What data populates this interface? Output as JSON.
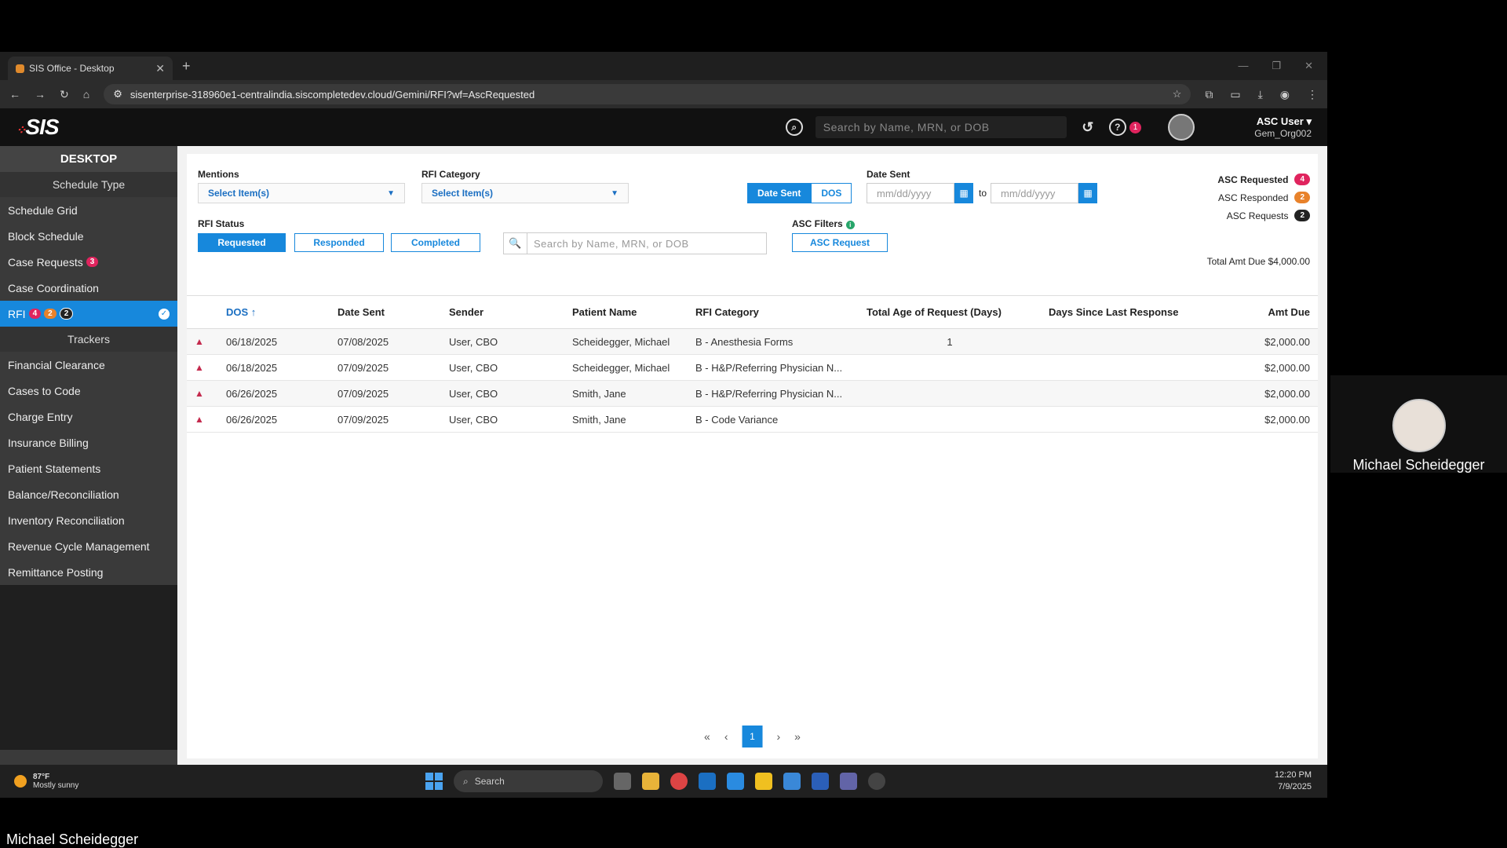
{
  "browser": {
    "tab_title": "SIS Office - Desktop",
    "url": "sisenterprise-318960e1-centralindia.siscompletedev.cloud/Gemini/RFI?wf=AscRequested"
  },
  "header": {
    "logo": "SIS",
    "search_placeholder": "Search by Name, MRN, or DOB",
    "help_badge": "1",
    "user_name": "ASC User",
    "user_org": "Gem_Org002"
  },
  "sidebar": {
    "title": "DESKTOP",
    "section1": "Schedule Type",
    "items1": [
      {
        "label": "Schedule Grid"
      },
      {
        "label": "Block Schedule"
      },
      {
        "label": "Case Requests",
        "badge": "3"
      },
      {
        "label": "Case Coordination"
      }
    ],
    "active": {
      "label": "RFI",
      "b1": "4",
      "b2": "2",
      "b3": "2"
    },
    "section2": "Trackers",
    "items2": [
      {
        "label": "Financial Clearance"
      },
      {
        "label": "Cases to Code"
      },
      {
        "label": "Charge Entry"
      },
      {
        "label": "Insurance Billing"
      },
      {
        "label": "Patient Statements"
      },
      {
        "label": "Balance/Reconciliation"
      },
      {
        "label": "Inventory Reconciliation"
      },
      {
        "label": "Revenue Cycle Management"
      },
      {
        "label": "Remittance Posting"
      }
    ]
  },
  "filters": {
    "mentions_label": "Mentions",
    "mentions_value": "Select Item(s)",
    "category_label": "RFI Category",
    "category_value": "Select Item(s)",
    "toggle_date_sent": "Date Sent",
    "toggle_dos": "DOS",
    "date_label": "Date Sent",
    "date_from_ph": "mm/dd/yyyy",
    "date_to": "to",
    "date_to_ph": "mm/dd/yyyy",
    "status_label": "RFI Status",
    "status_requested": "Requested",
    "status_responded": "Responded",
    "status_completed": "Completed",
    "search_placeholder": "Search by Name, MRN, or DOB",
    "asc_label": "ASC Filters",
    "asc_button": "ASC Request",
    "counts": [
      {
        "label": "ASC Requested",
        "value": "4",
        "color": "#e0245e"
      },
      {
        "label": "ASC Responded",
        "value": "2",
        "color": "#e8822b"
      },
      {
        "label": "ASC Requests",
        "value": "2",
        "color": "#222222"
      }
    ],
    "total_amt": "Total Amt Due $4,000.00"
  },
  "table": {
    "headers": [
      "DOS",
      "Date Sent",
      "Sender",
      "Patient Name",
      "RFI Category",
      "Total Age of Request (Days)",
      "Days Since Last Response",
      "Amt Due"
    ],
    "rows": [
      [
        "06/18/2025",
        "07/08/2025",
        "User, CBO",
        "Scheidegger, Michael",
        "B - Anesthesia Forms",
        "1",
        "",
        "$2,000.00"
      ],
      [
        "06/18/2025",
        "07/09/2025",
        "User, CBO",
        "Scheidegger, Michael",
        "B - H&P/Referring Physician N...",
        "",
        "",
        "$2,000.00"
      ],
      [
        "06/26/2025",
        "07/09/2025",
        "User, CBO",
        "Smith, Jane",
        "B - H&P/Referring Physician N...",
        "",
        "",
        "$2,000.00"
      ],
      [
        "06/26/2025",
        "07/09/2025",
        "User, CBO",
        "Smith, Jane",
        "B - Code Variance",
        "",
        "",
        "$2,000.00"
      ]
    ]
  },
  "pager": {
    "current": "1"
  },
  "taskbar": {
    "temp": "87°F",
    "weather": "Mostly sunny",
    "search": "Search",
    "time": "12:20 PM",
    "date": "7/9/2025"
  },
  "camera": {
    "name": "Michael Scheidegger"
  },
  "caption": "Michael Scheidegger"
}
